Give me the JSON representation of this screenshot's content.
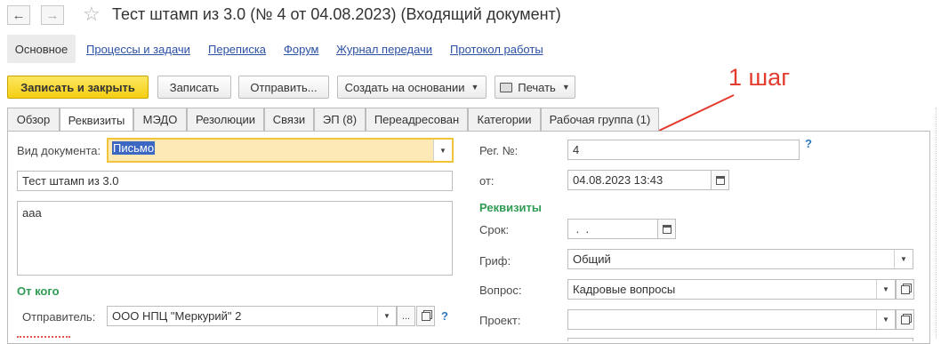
{
  "window": {
    "title": "Тест штамп из 3.0 (№ 4 от 04.08.2023) (Входящий документ)",
    "back_icon": "←",
    "forward_icon": "→"
  },
  "sections": {
    "active": "Основное",
    "links": [
      "Процессы и задачи",
      "Переписка",
      "Форум",
      "Журнал передачи",
      "Протокол работы"
    ]
  },
  "toolbar": {
    "save_close": "Записать и закрыть",
    "save": "Записать",
    "send": "Отправить...",
    "create_based": "Создать на основании",
    "print": "Печать"
  },
  "tabs": [
    "Обзор",
    "Реквизиты",
    "МЭДО",
    "Резолюции",
    "Связи",
    "ЭП (8)",
    "Переадресован",
    "Категории",
    "Рабочая группа (1)"
  ],
  "form": {
    "doc_type_label": "Вид документа:",
    "doc_type_value": "Письмо",
    "subject_value": "Тест штамп из 3.0",
    "content_value": "ааа",
    "from_title": "От кого",
    "sender_label": "Отправитель:",
    "sender_value": "ООО НПЦ \"Меркурий\" 2",
    "ellipsis": "...",
    "reg_no_label": "Рег. №:",
    "reg_no_value": "4",
    "date_label": "от:",
    "date_value": "04.08.2023 13:43",
    "requisites_title": "Реквизиты",
    "deadline_label": "Срок:",
    "deadline_value": " .  .",
    "stamp_label": "Гриф:",
    "stamp_value": "Общий",
    "question_label": "Вопрос:",
    "question_value": "Кадровые вопросы",
    "project_label": "Проект:",
    "project_value": "",
    "help_mark": "?"
  },
  "annotation": {
    "text": "1 шаг",
    "color": "#e33b2e"
  }
}
